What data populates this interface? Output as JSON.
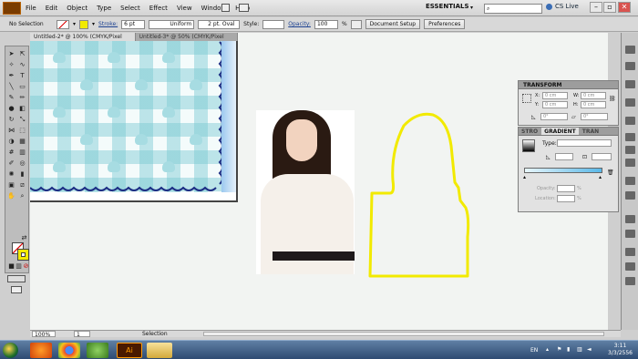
{
  "menubar": {
    "items": [
      "File",
      "Edit",
      "Object",
      "Type",
      "Select",
      "Effect",
      "View",
      "Window",
      "Help"
    ],
    "workspace": "ESSENTIALS",
    "cs_live": "CS Live"
  },
  "control_bar": {
    "selection": "No Selection",
    "stroke_label": "Stroke:",
    "stroke_value": "6 pt",
    "profile": "Uniform",
    "brush": "2 pt. Oval",
    "style_label": "Style:",
    "opacity_link": "Opacity:",
    "opacity_value": "100",
    "opacity_unit": "%",
    "doc_setup": "Document Setup",
    "preferences": "Preferences"
  },
  "document_tabs": [
    "Untitled-2* @ 100% (CMYK/Pixel Preview)",
    "Untitled-3* @ 50% (CMYK/Pixel Preview)"
  ],
  "panels": {
    "transform": {
      "title": "TRANSFORM",
      "x_label": "X:",
      "x_value": "0 cm",
      "y_label": "Y:",
      "y_value": "0 cm",
      "w_label": "W:",
      "w_value": "0 cm",
      "h_label": "H:",
      "h_value": "0 cm",
      "angle": "0°",
      "shear": "0°"
    },
    "gradient": {
      "tab_stroke": "STRO",
      "tab_gradient": "GRADIENT",
      "tab_trans": "TRAN",
      "type_label": "Type:",
      "opacity_label": "Opacity:",
      "opacity_unit": "%",
      "location_label": "Location:",
      "location_unit": "%"
    }
  },
  "status_bar": {
    "zoom": "100%",
    "page": "1",
    "tool": "Selection"
  },
  "taskbar": {
    "lang": "EN",
    "time": "3:11",
    "date": "3/3/2556"
  },
  "colors": {
    "stroke_color": "#f2ea00",
    "accent": "#1a3f8f"
  }
}
